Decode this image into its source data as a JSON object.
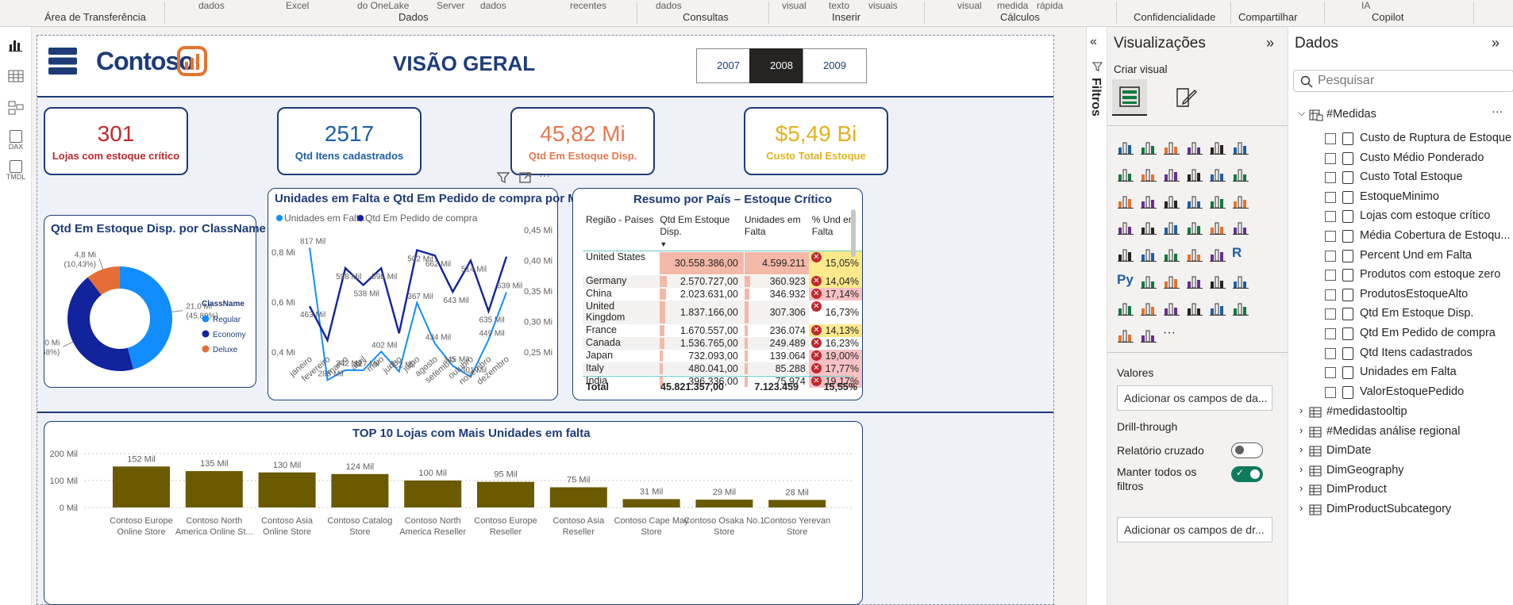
{
  "ribbon": {
    "top_items": [
      "dados",
      "Excel",
      "do OneLake",
      "Server",
      "dados",
      "recentes",
      "dados",
      "visual",
      "texto",
      "visuais",
      "visual",
      "medida",
      "rápida",
      "IA"
    ],
    "groups": [
      "Área de Transferência",
      "Dados",
      "Consultas",
      "Inserir",
      "Cálculos",
      "Confidencialidade",
      "Compartilhar",
      "Copilot"
    ]
  },
  "leftbar": {
    "icons": [
      "report-view-icon",
      "table-view-icon",
      "model-view-icon",
      "dax-query-icon",
      "tmdl-view-icon"
    ],
    "dax_label": "DAX",
    "tmdl_label": "TMDL"
  },
  "header": {
    "logo_text": "Contoso",
    "title": "VISÃO GERAL",
    "years": [
      "2007",
      "2008",
      "2009"
    ],
    "selected_year": "2008"
  },
  "kpis": [
    {
      "value": "301",
      "label": "Lojas com estoque crítico",
      "color": "#c0282d"
    },
    {
      "value": "2517",
      "label": "Qtd Itens cadastrados",
      "color": "#1d5fa5"
    },
    {
      "value": "45,82 Mi",
      "label": "Qtd Em Estoque Disp.",
      "color": "#e8774e"
    },
    {
      "value": "$5,49 Bi",
      "label": "Custo Total Estoque",
      "color": "#e3b120"
    }
  ],
  "donut": {
    "title": "Qtd Em Estoque Disp. por ClassName",
    "legend_title": "ClassName",
    "chart_data": {
      "type": "pie",
      "categories": [
        "Regular",
        "Economy",
        "Deluxe"
      ],
      "values": [
        21.0,
        20.0,
        4.8
      ],
      "percent": [
        "45,89%",
        "43,68%",
        "10,43%"
      ],
      "labels": [
        "21,0 Mi",
        "20,0 Mi",
        "4,8 Mi"
      ],
      "colors": [
        "#118dff",
        "#12239e",
        "#e66c37"
      ]
    }
  },
  "linechart": {
    "title": "Unidades em Falta e Qtd Em Pedido de compra por Mês",
    "toolbar": {
      "more": "···"
    },
    "chart_data": {
      "type": "line",
      "categories": [
        "janeiro",
        "fevereiro",
        "março",
        "abril",
        "maio",
        "junho",
        "julho",
        "agosto",
        "setembro",
        "outubro",
        "novembro",
        "dezembro"
      ],
      "series": [
        {
          "name": "Unidades em Falta",
          "color": "#118dff",
          "axis": "left",
          "values": [
            817,
            288,
            328,
            327,
            402,
            322,
            597,
            434,
            345,
            301,
            449,
            639
          ]
        },
        {
          "name": "Qtd Em Pedido de compra",
          "color": "#12239e",
          "axis": "right",
          "values": [
            463,
            342,
            598,
            538,
            598,
            367,
            662,
            643,
            514,
            625,
            445,
            639
          ]
        }
      ],
      "point_labels_a": [
        "817 Mil",
        "288 Mil",
        "342 Mil",
        "327 Mil",
        "402 Mil",
        "322 Mil",
        "367 Mil",
        "434 Mil",
        "345 Mil",
        "301 Mil",
        "449 Mil",
        "639 Mil"
      ],
      "point_labels_b": [
        "463 Mil",
        "598 Mil",
        "538 Mil",
        "598 Mil",
        "502 Mil",
        "662 Mil",
        "643 Mil",
        "514 Mil",
        "635 Mil"
      ],
      "y_left_ticks": [
        "0,8 Mi",
        "0,6 Mi",
        "0,4 Mi"
      ],
      "y_right_ticks": [
        "0,45 Mi",
        "0,40 Mi",
        "0,35 Mi",
        "0,30 Mi",
        "0,25 Mi"
      ]
    }
  },
  "table": {
    "title": "Resumo por País – Estoque Crítico",
    "columns": [
      "Região - Países",
      "Qtd Em Estoque Disp.",
      "Unidades em Falta",
      "% Und em Falta"
    ],
    "rows": [
      {
        "country": "United States",
        "stock": "30.558.386,00",
        "missing": "4.599.211",
        "pct": "15,05%",
        "stock_pct": 1.0,
        "missing_pct": 1.0,
        "pct_color": "#fde98a"
      },
      {
        "country": "Germany",
        "stock": "2.570.727,00",
        "missing": "360.923",
        "pct": "14,04%",
        "stock_pct": 0.08,
        "missing_pct": 0.08,
        "pct_color": "#fde98a"
      },
      {
        "country": "China",
        "stock": "2.023.631,00",
        "missing": "346.932",
        "pct": "17,14%",
        "stock_pct": 0.07,
        "missing_pct": 0.07,
        "pct_color": "#f8c1c4"
      },
      {
        "country": "United Kingdom",
        "stock": "1.837.166,00",
        "missing": "307.306",
        "pct": "16,73%",
        "stock_pct": 0.06,
        "missing_pct": 0.06,
        "pct_color": "#fff"
      },
      {
        "country": "France",
        "stock": "1.670.557,00",
        "missing": "236.074",
        "pct": "14,13%",
        "stock_pct": 0.05,
        "missing_pct": 0.05,
        "pct_color": "#fde98a"
      },
      {
        "country": "Canada",
        "stock": "1.536.765,00",
        "missing": "249.489",
        "pct": "16,23%",
        "stock_pct": 0.05,
        "missing_pct": 0.05,
        "pct_color": "#fff"
      },
      {
        "country": "Japan",
        "stock": "732.093,00",
        "missing": "139.064",
        "pct": "19,00%",
        "stock_pct": 0.025,
        "missing_pct": 0.03,
        "pct_color": "#f8c1c4"
      },
      {
        "country": "Italy",
        "stock": "480.041,00",
        "missing": "85.288",
        "pct": "17,77%",
        "stock_pct": 0.016,
        "missing_pct": 0.02,
        "pct_color": "#f8c1c4"
      },
      {
        "country": "India",
        "stock": "396.336,00",
        "missing": "75.974",
        "pct": "19,17%",
        "stock_pct": 0.013,
        "missing_pct": 0.017,
        "pct_color": "#f8c1c4"
      }
    ],
    "total": {
      "label": "Total",
      "stock": "45.821.357,00",
      "missing": "7.123.459",
      "pct": "15,55%"
    }
  },
  "barchart": {
    "title": "TOP 10 Lojas com Mais Unidades em falta",
    "chart_data": {
      "type": "bar",
      "categories": [
        "Contoso Europe Online Store",
        "Contoso North America Online St...",
        "Contoso Asia Online Store",
        "Contoso Catalog Store",
        "Contoso North America Reseller",
        "Contoso Europe Reseller",
        "Contoso Asia Reseller",
        "Contoso Cape May Store",
        "Contoso Osaka No.1 Store",
        "Contoso Yerevan Store"
      ],
      "values": [
        152,
        135,
        130,
        124,
        100,
        95,
        75,
        31,
        29,
        28
      ],
      "labels": [
        "152 Mil",
        "135 Mil",
        "130 Mil",
        "124 Mil",
        "100 Mil",
        "95 Mil",
        "75 Mil",
        "31 Mil",
        "29 Mil",
        "28 Mil"
      ],
      "y_ticks": [
        "200 Mil",
        "100 Mil",
        "0 Mil"
      ],
      "ylim": [
        0,
        200
      ],
      "color": "#6b5a00"
    }
  },
  "filters": {
    "label": "Filtros"
  },
  "viz": {
    "title": "Visualizações",
    "create_label": "Criar visual",
    "values_label": "Valores",
    "add_fields": "Adicionar os campos de da...",
    "drill_label": "Drill-through",
    "cross_report": "Relatório cruzado",
    "keep_filters": "Manter todos os filtros",
    "add_drill": "Adicionar os campos de dr...",
    "more": "···",
    "python_label": "Py",
    "r_label": "R"
  },
  "data_pane": {
    "title": "Dados",
    "search_placeholder": "Pesquisar",
    "group": "#Medidas",
    "measures": [
      "Custo de Ruptura de Estoque",
      "Custo Médio Ponderado",
      "Custo Total Estoque",
      "EstoqueMinimo",
      "Lojas com estoque crítico",
      "Média Cobertura de Estoqu...",
      "Percent Und em Falta",
      "Produtos com estoque zero",
      "ProdutosEstoqueAlto",
      "Qtd Em Estoque Disp.",
      "Qtd Em Pedido de compra",
      "Qtd Itens cadastrados",
      "Unidades em Falta",
      "ValorEstoquePedido"
    ],
    "tables": [
      "#medidastooltip",
      "#Medidas análise regional",
      "DimDate",
      "DimGeography",
      "DimProduct",
      "DimProductSubcategory"
    ],
    "more": "···"
  }
}
